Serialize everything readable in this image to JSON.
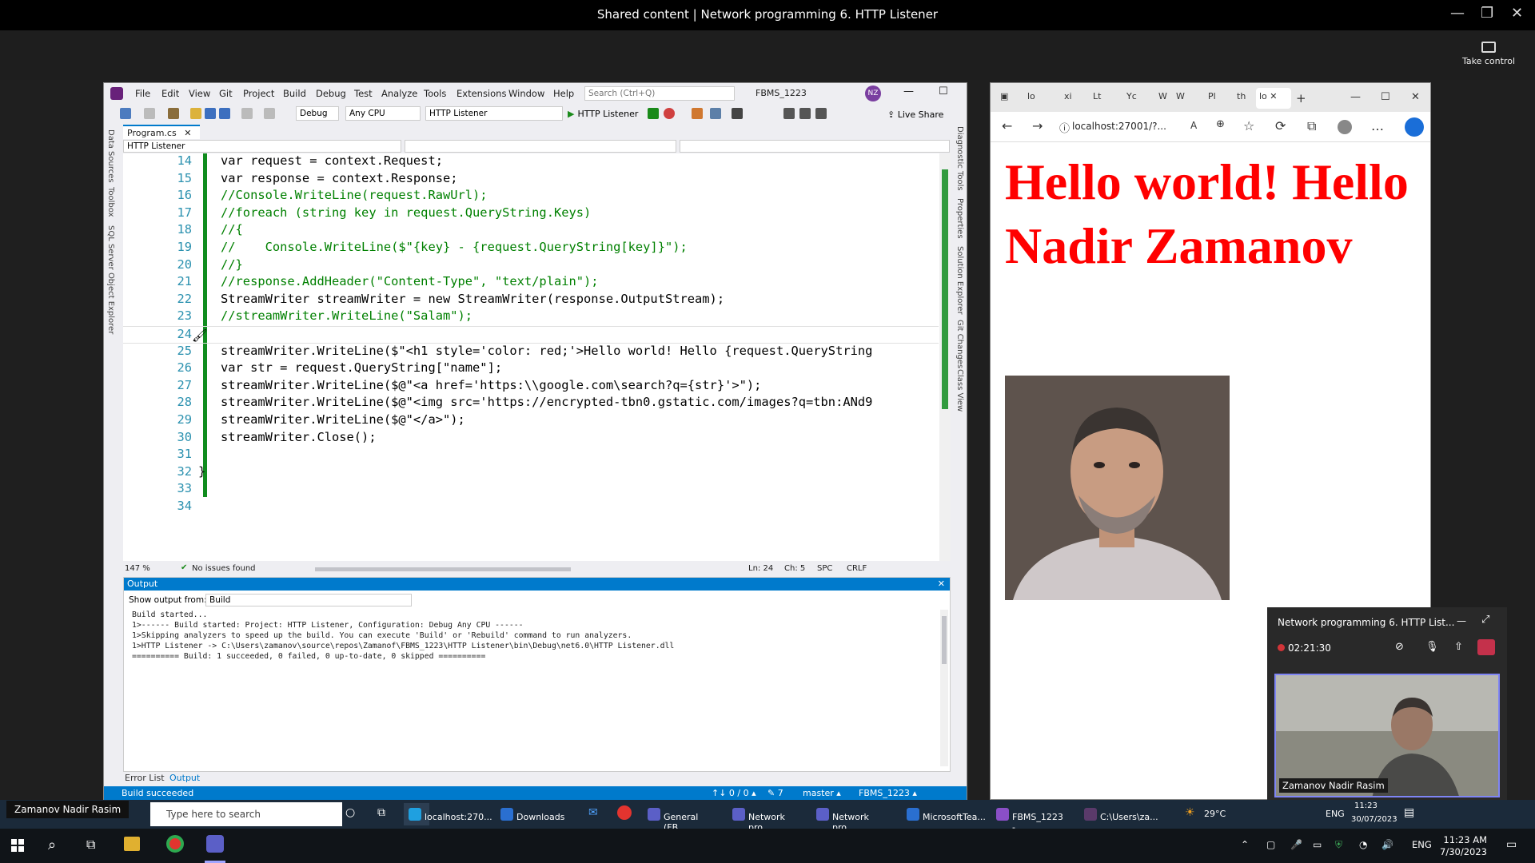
{
  "window_title": "Shared content | Network programming 6. HTTP Listener",
  "take_control": "Take control",
  "vs": {
    "menu": [
      "File",
      "Edit",
      "View",
      "Git",
      "Project",
      "Build",
      "Debug",
      "Test",
      "Analyze",
      "Tools",
      "Extensions",
      "Window",
      "Help"
    ],
    "search_placeholder": "Search (Ctrl+Q)",
    "solution": "FBMS_1223",
    "avatar": "NZ",
    "config": "Debug",
    "platform": "Any CPU",
    "startup_project": "HTTP Listener",
    "run_label": "HTTP Listener",
    "live_share": "Live Share",
    "doc_tab": "Program.cs",
    "nav_project": "HTTP Listener",
    "left_tabs": [
      "Data Sources",
      "Toolbox",
      "SQL Server Object Explorer"
    ],
    "right_tabs": [
      "Diagnostic Tools",
      "Properties",
      "Solution Explorer",
      "Git Changes",
      "Class View"
    ],
    "lines": [
      {
        "n": "14",
        "text": "var request = context.Request;"
      },
      {
        "n": "15",
        "text": "var response = context.Response;"
      },
      {
        "n": "16",
        "text": "//Console.WriteLine(request.RawUrl);"
      },
      {
        "n": "17",
        "text": "//foreach (string key in request.QueryString.Keys)"
      },
      {
        "n": "18",
        "text": "//{"
      },
      {
        "n": "19",
        "text": "//    Console.WriteLine($\"{key} - {request.QueryString[key]}\");"
      },
      {
        "n": "20",
        "text": "//}"
      },
      {
        "n": "21",
        "text": "//response.AddHeader(\"Content-Type\", \"text/plain\");"
      },
      {
        "n": "22",
        "text": "StreamWriter streamWriter = new StreamWriter(response.OutputStream);"
      },
      {
        "n": "23",
        "text": "//streamWriter.WriteLine(\"Salam\");"
      },
      {
        "n": "24",
        "text": ""
      },
      {
        "n": "25",
        "text": "streamWriter.WriteLine($\"<h1 style='color: red;'>Hello world! Hello {request.QueryString"
      },
      {
        "n": "26",
        "text": "var str = request.QueryString[\"name\"];"
      },
      {
        "n": "27",
        "text": "streamWriter.WriteLine($@\"<a href='https:\\\\google.com\\search?q={str}'>\");"
      },
      {
        "n": "28",
        "text": "streamWriter.WriteLine($@\"<img src='https://encrypted-tbn0.gstatic.com/images?q=tbn:ANd9"
      },
      {
        "n": "29",
        "text": "streamWriter.WriteLine($@\"</a>\");"
      },
      {
        "n": "30",
        "text": "streamWriter.Close();"
      },
      {
        "n": "31",
        "text": ""
      },
      {
        "n": "32",
        "text": "}"
      },
      {
        "n": "33",
        "text": ""
      },
      {
        "n": "34",
        "text": ""
      }
    ],
    "zoom": "147 %",
    "issues": "No issues found",
    "cursor": "Ln: 24",
    "col": "Ch: 5",
    "spc": "SPC",
    "crlf": "CRLF",
    "output_title": "Output",
    "show_output_from": "Show output from:",
    "output_source": "Build",
    "output_text": "Build started...\n1>------ Build started: Project: HTTP Listener, Configuration: Debug Any CPU ------\n1>Skipping analyzers to speed up the build. You can execute 'Build' or 'Rebuild' command to run analyzers.\n1>HTTP Listener -> C:\\Users\\zamanov\\source\\repos\\Zamanof\\FBMS_1223\\HTTP Listener\\bin\\Debug\\net6.0\\HTTP Listener.dll\n========== Build: 1 succeeded, 0 failed, 0 up-to-date, 0 skipped ==========",
    "tab_error_list": "Error List",
    "tab_output": "Output",
    "status_build": "Build succeeded",
    "status_arrows": "↑↓ 0 / 0 ▴",
    "status_pencil": "✎ 7",
    "status_branch": "master ▴",
    "status_repo": "FBMS_1223 ▴"
  },
  "browser": {
    "url": "localhost:27001/?...",
    "heading": "Hello world! Hello Nadir Zamanov",
    "tab_letters": [
      "lo",
      "xi",
      "Lt",
      "Yc",
      "W",
      "W",
      "Pl",
      "th",
      "lo"
    ]
  },
  "teams": {
    "title": "Network programming 6. HTTP List...",
    "timer": "02:21:30",
    "participant": "Zamanov Nadir Rasim"
  },
  "presenter_label": "Zamanov Nadir Rasim",
  "inner_taskbar": {
    "search": "Type here to search",
    "items": [
      "localhost:270...",
      "Downloads",
      "General (FB...",
      "Network pro...",
      "Network pro...",
      "MicrosoftTea...",
      "FBMS_1223 - ...",
      "C:\\Users\\za..."
    ],
    "weather": "29°C",
    "lang": "ENG",
    "time": "11:23",
    "date": "30/07/2023"
  },
  "outer_taskbar": {
    "lang": "ENG",
    "time": "11:23 AM",
    "date": "7/30/2023"
  },
  "colors": {
    "accent": "#007acc",
    "red": "#ff0000",
    "teams": "#7f85f5"
  }
}
